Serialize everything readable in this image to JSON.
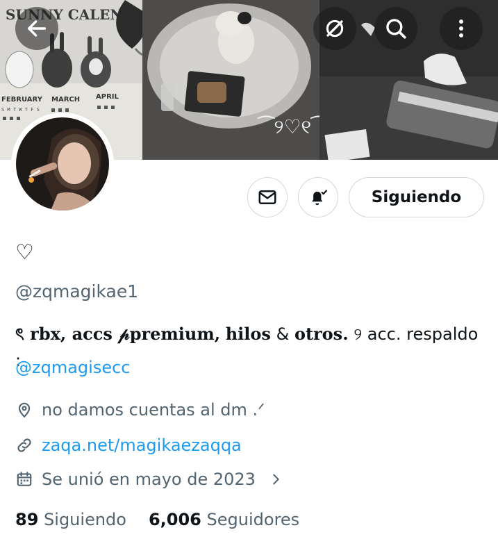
{
  "header": {
    "back_icon": "arrow-left-icon",
    "grok_icon": "slash-circle-icon",
    "search_icon": "search-icon",
    "more_icon": "more-vertical-icon"
  },
  "banner": {
    "calendar_title": "SUNNY CALEN",
    "month_1": "FEBRUARY",
    "month_2": "MARCH",
    "month_3": "APRIL",
    "weekday_row": "S M T W T F S",
    "center_glyph": "⁀୨♡୧⁀"
  },
  "actions": {
    "message_icon": "mail-icon",
    "notify_icon": "bell-check-icon",
    "follow_label": "Siguiendo"
  },
  "profile": {
    "display_name": "♡",
    "handle": "@zqmagikae1",
    "bio_part1": "ৎ rbx, accs",
    "bio_part2": "premium,",
    "bio_part3": "hilos",
    "bio_part4": "&",
    "bio_part5": "otros.",
    "bio_part6": "୨ acc. respaldo :",
    "bio_p": "𝓅",
    "bio_mention": "@zqmagisecc",
    "location": "no damos cuentas al dm .ᐟ",
    "website": "zaqa.net/magikaezaqqa",
    "joined": "Se unió en mayo de 2023",
    "following_count": "89",
    "following_label": "Siguiendo",
    "followers_count": "6,006",
    "followers_label": "Seguidores"
  },
  "colors": {
    "link": "#1d9bf0",
    "secondary_text": "#536471",
    "border": "#cfd9de"
  }
}
